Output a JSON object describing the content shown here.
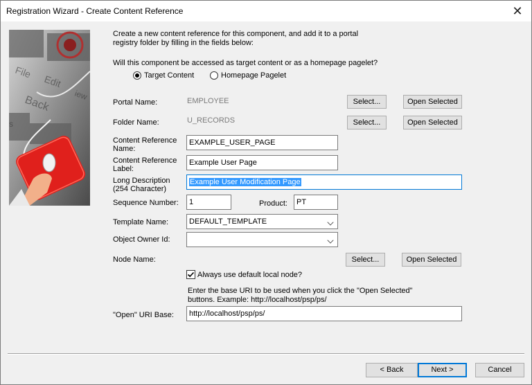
{
  "window": {
    "title": "Registration Wizard - Create Content Reference"
  },
  "intro": {
    "line1": "Create a new content reference for this component, and add it to a portal",
    "line2": "registry folder by filling in the fields below:"
  },
  "question": "Will this component be accessed as target content or as a homepage pagelet?",
  "radios": {
    "target": {
      "label": "Target Content",
      "selected": true
    },
    "pagelet": {
      "label": "Homepage Pagelet",
      "selected": false
    }
  },
  "portal": {
    "label": "Portal Name:",
    "value": "EMPLOYEE",
    "select_label": "Select...",
    "open_label": "Open Selected"
  },
  "folder": {
    "label": "Folder Name:",
    "value": "U_RECORDS",
    "select_label": "Select...",
    "open_label": "Open Selected"
  },
  "content_ref_name": {
    "label1": "Content Reference",
    "label2": "Name:",
    "value": "EXAMPLE_USER_PAGE"
  },
  "content_ref_label": {
    "label1": "Content Reference",
    "label2": "Label:",
    "value": "Example User Page"
  },
  "long_description": {
    "label1": "Long Description",
    "label2": "(254 Character)",
    "value": "Example User Modification Page"
  },
  "sequence": {
    "label": "Sequence Number:",
    "value": "1"
  },
  "product": {
    "label": "Product:",
    "value": "PT"
  },
  "template": {
    "label": "Template Name:",
    "value": "DEFAULT_TEMPLATE"
  },
  "object_owner": {
    "label": "Object Owner Id:",
    "value": ""
  },
  "node": {
    "label": "Node Name:",
    "select_label": "Select...",
    "open_label": "Open Selected"
  },
  "default_node": {
    "label": "Always use default local node?",
    "checked": true
  },
  "uri_help": {
    "line1": "Enter the base URI to be used when you click the \"Open Selected\"",
    "line2": "buttons.  Example:  http://localhost/psp/ps/"
  },
  "uri_base": {
    "label": "\"Open\" URI Base:",
    "value": "http://localhost/psp/ps/"
  },
  "footer": {
    "back": "< Back",
    "next": "Next >",
    "cancel": "Cancel"
  },
  "colors": {
    "accent": "#0078d7",
    "selection": "#3399ff",
    "artwork_red": "#e0201c"
  },
  "icons": {
    "close": "close-icon",
    "artwork": "wizard-artwork-image",
    "dropdown": "chevron-down-icon",
    "check": "checkmark-icon"
  }
}
